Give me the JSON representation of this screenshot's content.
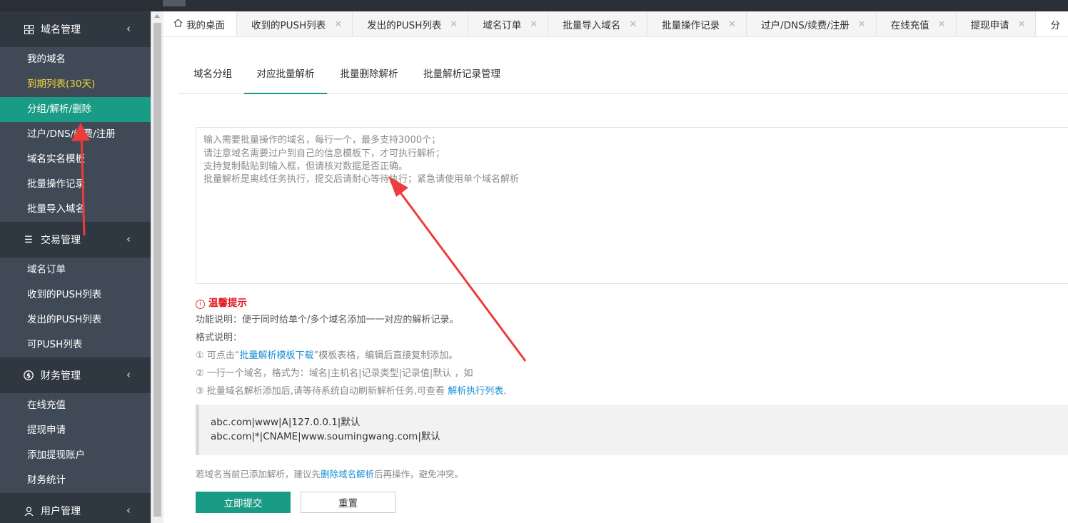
{
  "sidebar": {
    "groups": [
      {
        "title": "域名管理",
        "icon": "grid-icon",
        "items": [
          {
            "label": "我的域名"
          },
          {
            "label": "到期列表(30天)"
          },
          {
            "label": "分组/解析/删除"
          },
          {
            "label": "过户/DNS/续费/注册"
          },
          {
            "label": "域名实名模板"
          },
          {
            "label": "批量操作记录"
          },
          {
            "label": "批量导入域名"
          }
        ]
      },
      {
        "title": "交易管理",
        "icon": "list-icon",
        "items": [
          {
            "label": "域名订单"
          },
          {
            "label": "收到的PUSH列表"
          },
          {
            "label": "发出的PUSH列表"
          },
          {
            "label": "可PUSH列表"
          }
        ]
      },
      {
        "title": "财务管理",
        "icon": "dollar-icon",
        "items": [
          {
            "label": "在线充值"
          },
          {
            "label": "提现申请"
          },
          {
            "label": "添加提现账户"
          },
          {
            "label": "财务统计"
          }
        ]
      },
      {
        "title": "用户管理",
        "icon": "user-icon",
        "items": []
      }
    ],
    "active_item": "分组/解析/删除"
  },
  "tabs": [
    {
      "label": "我的桌面"
    },
    {
      "label": "收到的PUSH列表"
    },
    {
      "label": "发出的PUSH列表"
    },
    {
      "label": "域名订单"
    },
    {
      "label": "批量导入域名"
    },
    {
      "label": "批量操作记录"
    },
    {
      "label": "过户/DNS/续费/注册"
    },
    {
      "label": "在线充值"
    },
    {
      "label": "提现申请"
    },
    {
      "label": "分"
    }
  ],
  "subtabs": [
    {
      "label": "域名分组"
    },
    {
      "label": "对应批量解析"
    },
    {
      "label": "批量删除解析"
    },
    {
      "label": "批量解析记录管理"
    }
  ],
  "textarea": {
    "placeholder_lines": [
      "输入需要批量操作的域名，每行一个，最多支持3000个；",
      "请注意域名需要过户到自己的信息模板下，才可执行解析；",
      "支持复制黏贴到输入框，但请核对数据是否正确。",
      "批量解析是离线任务执行，提交后请耐心等待执行；紧急请使用单个域名解析"
    ]
  },
  "tips": {
    "title": "温馨提示",
    "function_desc": "功能说明：便于同时给单个/多个域名添加一一对应的解析记录。",
    "format_title": "格式说明：",
    "step1_prefix": "① 可点击“",
    "step1_link": "批量解析模板下载",
    "step1_suffix": "”模板表格，编辑后直接复制添加。",
    "step2": "② 一行一个域名，格式为：域名|主机名|记录类型|记录值|默认 ，如",
    "step3_prefix": "③ 批量域名解析添加后,请等待系统自动刷新解析任务,可查看 ",
    "step3_link": "解析执行列表.",
    "example_lines": [
      "abc.com|www|A|127.0.0.1|默认",
      "abc.com|*|CNAME|www.soumingwang.com|默认"
    ],
    "note_prefix": "若域名当前已添加解析，建议先",
    "note_link": "删除域名解析",
    "note_suffix": "后再操作，避免冲突。"
  },
  "buttons": {
    "submit": "立即提交",
    "reset": "重置"
  },
  "colors": {
    "accent": "#1a9b86",
    "sidebar_bg": "#404a56",
    "sidebar_head": "#2f3740",
    "warn": "#f2d43b",
    "arrow": "#ee3b3b"
  }
}
